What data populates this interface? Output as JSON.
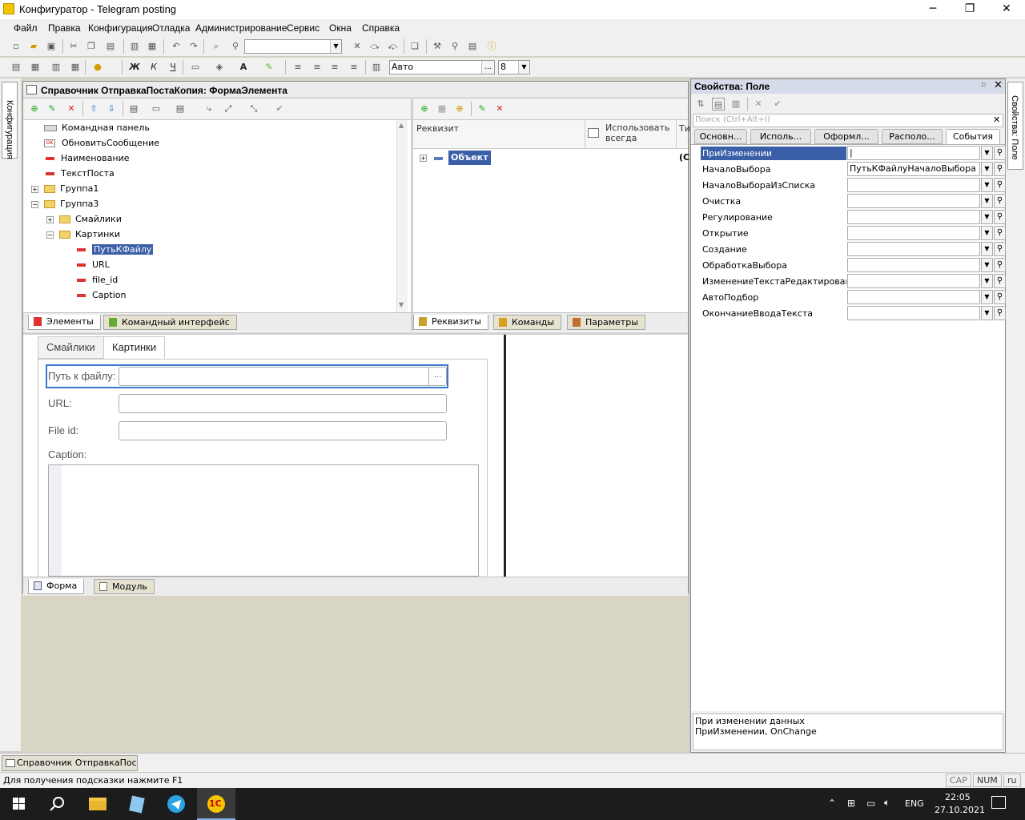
{
  "window": {
    "title": "Конфигуратор - Telegram posting",
    "minimize": "─",
    "maximize": "❐",
    "close": "✕"
  },
  "menu": [
    "Файл",
    "Правка",
    "Конфигурация",
    "Отладка",
    "Администрирование",
    "Сервис",
    "Окна",
    "Справка"
  ],
  "toolbar": {
    "font_value": "Авто",
    "size_value": "8",
    "dots": "..."
  },
  "left_strip": {
    "label": "Конфигурация"
  },
  "form_window": {
    "title": "Справочник ОтправкаПостаКопия: ФормаЭлемента",
    "tree": [
      {
        "label": "Командная панель",
        "icon": "command-panel"
      },
      {
        "label": "ОбновитьСообщение",
        "icon": "ok-button"
      },
      {
        "label": "Наименование",
        "icon": "field"
      },
      {
        "label": "ТекстПоста",
        "icon": "field"
      },
      {
        "label": "Группа1",
        "icon": "folder",
        "expander": "+"
      },
      {
        "label": "Группа3",
        "icon": "folder",
        "expander": "−"
      },
      {
        "label": "Смайлики",
        "icon": "folder",
        "expander": "+"
      },
      {
        "label": "Картинки",
        "icon": "folder",
        "expander": "−"
      },
      {
        "label": "ПутьКФайлу",
        "icon": "field",
        "selected": true
      },
      {
        "label": "URL",
        "icon": "field"
      },
      {
        "label": "file_id",
        "icon": "field"
      },
      {
        "label": "Caption",
        "icon": "field"
      }
    ],
    "left_tabs": [
      "Элементы",
      "Командный интерфейс"
    ],
    "attr_columns": [
      "Реквизит",
      "Использовать всегда",
      "Ти"
    ],
    "attr_root": "Объект",
    "attr_root_type": "(С",
    "right_tabs": [
      "Реквизиты",
      "Команды",
      "Параметры"
    ],
    "preview": {
      "tabs": [
        "Смайлики",
        "Картинки"
      ],
      "fields": [
        {
          "label": "Путь к файлу:",
          "button": "..."
        },
        {
          "label": "URL:"
        },
        {
          "label": "File id:"
        }
      ],
      "caption_label": "Caption:"
    },
    "bottom_tabs": [
      "Форма",
      "Модуль"
    ]
  },
  "properties": {
    "title": "Свойства: Поле",
    "search_placeholder": "Поиск (Ctrl+Alt+I)",
    "tabs": [
      "Основн...",
      "Исполь...",
      "Оформл...",
      "Располо...",
      "События"
    ],
    "rows": [
      {
        "name": "ПриИзменении",
        "value": "|",
        "selected": true
      },
      {
        "name": "НачалоВыбора",
        "value": "ПутьКФайлуНачалоВыбора"
      },
      {
        "name": "НачалоВыбораИзСписка",
        "value": ""
      },
      {
        "name": "Очистка",
        "value": ""
      },
      {
        "name": "Регулирование",
        "value": ""
      },
      {
        "name": "Открытие",
        "value": ""
      },
      {
        "name": "Создание",
        "value": ""
      },
      {
        "name": "ОбработкаВыбора",
        "value": ""
      },
      {
        "name": "ИзменениеТекстаРедактирования",
        "value": ""
      },
      {
        "name": "АвтоПодбор",
        "value": ""
      },
      {
        "name": "ОкончаниеВводаТекста",
        "value": ""
      }
    ],
    "description_line1": "При изменении данных",
    "description_line2": "ПриИзменении, OnChange"
  },
  "right_strip": {
    "label": "Свойства: Поле"
  },
  "window_list": {
    "item": "Справочник ОтправкаПоста..."
  },
  "status": {
    "text": "Для получения подсказки нажмите F1",
    "cap": "CAP",
    "num": "NUM",
    "lang": "ru"
  },
  "taskbar": {
    "time": "22:05",
    "date": "27.10.2021",
    "lang": "ENG",
    "onec": "1С"
  },
  "colors": {
    "selection": "#3b5ea8",
    "accent_blue": "#1e6fd9",
    "taskbar": "#1c1c1c"
  }
}
